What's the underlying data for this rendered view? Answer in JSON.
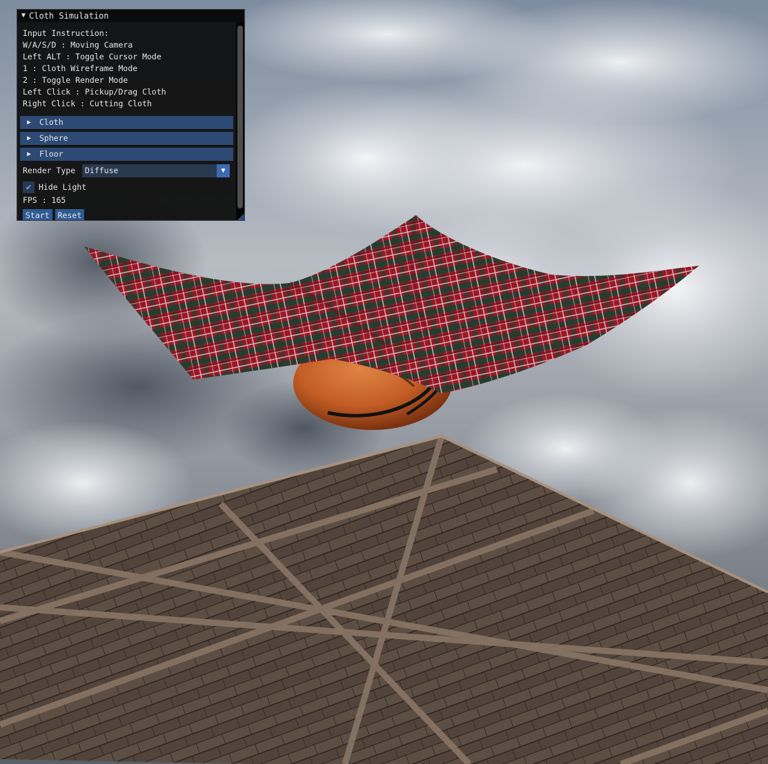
{
  "window": {
    "title": "Cloth Simulation",
    "instructions": [
      "Input Instruction:",
      "W/A/S/D : Moving Camera",
      "Left ALT : Toggle Cursor Mode",
      "1 : Cloth Wireframe Mode",
      "2 : Toggle Render Mode",
      "Left Click : Pickup/Drag Cloth",
      "Right Click : Cutting Cloth"
    ],
    "headers": [
      "Cloth",
      "Sphere",
      "Floor"
    ],
    "render_type": {
      "label": "Render Type",
      "value": "Diffuse"
    },
    "hide_light": {
      "label": "Hide Light",
      "checked": true
    },
    "fps": "FPS : 165",
    "buttons": {
      "start": "Start",
      "reset": "Reset"
    }
  },
  "icons": {
    "collapse": "triangle-down-icon",
    "header_arrow": "triangle-right-icon",
    "combo_arrow": "triangle-down-icon",
    "check": "checkmark-icon"
  },
  "colors": {
    "window_bg": "#0d0d0d",
    "header_bg": "#2c4a74",
    "button_bg": "#2d5a92",
    "accent": "#3c6ab0",
    "cloth_red": "#b51c2e",
    "cloth_green": "#1f4a36",
    "ball_orange": "#c8632a",
    "wood_brown": "#5a4a40"
  }
}
